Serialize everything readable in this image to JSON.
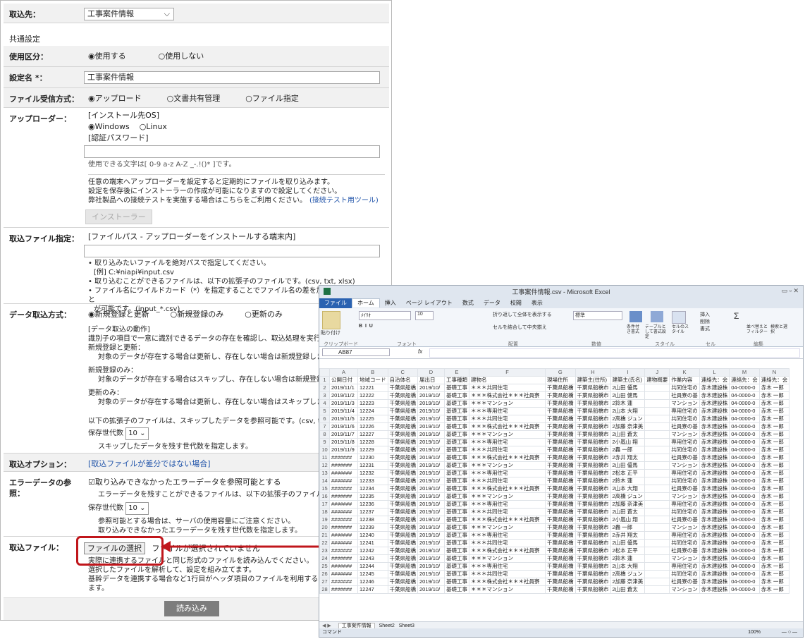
{
  "form": {
    "source_label": "取込先：",
    "source_value": "工事案件情報",
    "common_heading": "共通設定",
    "usage_label": "使用区分：",
    "usage_on": "◉使用する",
    "usage_off": "○使用しない",
    "setting_name_label": "設定名 *：",
    "setting_name_value": "工事案件情報",
    "receive_label": "ファイル受信方式：",
    "receive_upload": "◉アップロード",
    "receive_docshare": "○文書共有管理",
    "receive_file": "○ファイル指定",
    "uploader_label": "アップローダー：",
    "install_os_label": "[インストール先OS]",
    "os_windows": "◉Windows",
    "os_linux": "○Linux",
    "auth_pw_label": "[認証パスワード]",
    "pw_hint": "使用できる文字は[ 0-9 a-z A-Z _-.!()* ]です。",
    "uploader_note1": "任意の端末へアップローダーを設定すると定期的にファイルを取り込みます。",
    "uploader_note2": "設定を保存後にインストーラーの作成が可能になりますので設定してください。",
    "uploader_note3": "弊社製品への接続テストを実施する場合はこちらをご利用ください。",
    "uploader_note3_link": "(接続テスト用ツール)",
    "installer_button": "インストーラー",
    "import_file_label": "取込ファイル指定：",
    "file_path_label": "[ファイルパス - アップローダーをインストールする端末内]",
    "path_note1": "• 取り込みたいファイルを絶対パスで指定してください。",
    "path_note2": "[例] C:¥niapi¥input.csv",
    "path_note3": "• 取り込むことができるファイルは、以下の拡張子のファイルです。(csv, txt, xlsx)",
    "path_note4": "• ファイル名にワイルドカード（*）を指定することでファイル名の差を加味して取り込むこと",
    "path_note5": "が可能です。(input_*.csv)",
    "method_label": "データ取込方式：",
    "method_new_update": "◉新規登録と更新",
    "method_new_only": "○新規登録のみ",
    "method_update_only": "○更新のみ",
    "method_desc_title": "[データ取込の動作]",
    "method_desc1": "識別子の項目で一意に識別できるデータの存在を確認し、取込処理を実行し",
    "method_desc2": "新規登録と更新：",
    "method_desc3": "対象のデータが存在する場合は更新し、存在しない場合は新規登録します",
    "method_desc4": "新規登録のみ：",
    "method_desc5": "対象のデータが存在する場合はスキップし、存在しない場合は新規登録し",
    "method_desc6": "更新のみ：",
    "method_desc7": "対象のデータが存在する場合は更新し、存在しない場合はスキップします",
    "skip_note": "以下の拡張子のファイルは、スキップしたデータを参照可能です。(csv, txt",
    "keep_gen_label": "保存世代数",
    "keep_gen_value": "10",
    "skip_keep_note": "スキップしたデータを残す世代数を指定します。",
    "option_label": "取込オプション：",
    "option_link": "[取込ファイルが差分ではない場合]",
    "error_label": "エラーデータの参照：",
    "error_check": "☑取り込みできなかったエラーデータを参照可能とする",
    "error_note1": "エラーデータを残すことができるファイルは、以下の拡張子のファイルで",
    "error_keep_label": "保存世代数",
    "error_keep_value": "10",
    "error_note2": "参照可能とする場合は、サーバの使用容量にご注意ください。",
    "error_note3": "取り込みできなかったエラーデータを残す世代数を指定します。",
    "file_label": "取込ファイル：",
    "choose_file_button": "ファイルの選択",
    "no_file_text": "ファイルが選択されていません",
    "file_note1": "実際に連携するファイルと同じ形式のファイルを読み込んでください。",
    "file_note2": "選択したファイルを解析して、設定を組み立てます。",
    "file_note3": "基幹データを連携する場合など1行目がヘッダ項目のファイルを利用すると自",
    "file_note4": "ます。",
    "load_button": "読み込み"
  },
  "excel": {
    "title": "工事案件情報.csv - Microsoft Excel",
    "tabs": [
      "ファイル",
      "ホーム",
      "挿入",
      "ページ レイアウト",
      "数式",
      "データ",
      "校閲",
      "表示"
    ],
    "font_name": "ﾒｲﾘｵ",
    "font_size": "10",
    "wrap_text": "折り返して全体を表示する",
    "merge_center": "セルを結合して中央揃え",
    "number_format": "標準",
    "groups": [
      "クリップボード",
      "フォント",
      "配置",
      "数値",
      "スタイル",
      "セル",
      "編集"
    ],
    "cond_format": "条件付き書式",
    "table_format": "テーブルとして書式設定",
    "cell_style": "セルのスタイル",
    "insert": "挿入",
    "delete": "削除",
    "format": "書式",
    "sort": "並べ替えとフィルター",
    "find": "検索と選択",
    "paste": "貼り付け",
    "name_box": "AB87",
    "fx": "fx",
    "columns": [
      "A",
      "B",
      "C",
      "D",
      "E",
      "F",
      "G",
      "H",
      "I",
      "J",
      "K",
      "L",
      "M",
      "N"
    ],
    "headers": [
      "公開日付",
      "地域コード",
      "自治体名",
      "届出日",
      "工事種類",
      "建物名",
      "現場住所",
      "建築主(住所)",
      "建築主(氏名)",
      "建物概要",
      "作業内容",
      "連絡先：会",
      "連絡先：会",
      "連絡先：会"
    ],
    "rows": [
      [
        "2019/11/1",
        "12221",
        "千葉県船橋",
        "2019/10/",
        "基礎工事",
        "＊＊＊共同住宅",
        "千葉県船橋",
        "千葉県船橋市",
        "2山田 優馬",
        "",
        "共同住宅の",
        "赤木建設株",
        "04-0000-0",
        "赤木 一郎"
      ],
      [
        "2019/11/2",
        "12222",
        "千葉県船橋",
        "2019/10/",
        "基礎工事",
        "＊＊＊株式会社＊＊＊社員寮",
        "千葉県船橋",
        "千葉県船橋市",
        "2山田 健馬",
        "",
        "社員寮の基",
        "赤木建設株",
        "04-0000-0",
        "赤木 一郎"
      ],
      [
        "2019/11/3",
        "12223",
        "千葉県船橋",
        "2019/10/",
        "基礎工事",
        "＊＊＊マンション",
        "千葉県船橋",
        "千葉県船橋市",
        "2鈴木 蓮",
        "",
        "マンション",
        "赤木建設株",
        "04-0000-0",
        "赤木 一郎"
      ],
      [
        "2019/11/4",
        "12224",
        "千葉県船橋",
        "2019/10/",
        "基礎工事",
        "＊＊＊専用住宅",
        "千葉県船橋",
        "千葉県船橋市",
        "2山本 大翔",
        "",
        "専用住宅の",
        "赤木建設株",
        "04-0000-0",
        "赤木 一郎"
      ],
      [
        "2019/11/5",
        "12225",
        "千葉県船橋",
        "2019/10/",
        "基礎工事",
        "＊＊＊共同住宅",
        "千葉県船橋",
        "千葉県船橋市",
        "2高橋 ジュン",
        "",
        "共同住宅の",
        "赤木建設株",
        "04-0000-0",
        "赤木 一郎"
      ],
      [
        "2019/11/6",
        "12226",
        "千葉県船橋",
        "2019/10/",
        "基礎工事",
        "＊＊＊株式会社＊＊＊社員寮",
        "千葉県船橋",
        "千葉県船橋市",
        "2加藤 奈津美",
        "",
        "社員寮の基",
        "赤木建設株",
        "04-0000-0",
        "赤木 一郎"
      ],
      [
        "2019/11/7",
        "12227",
        "千葉県船橋",
        "2019/10/",
        "基礎工事",
        "＊＊＊マンション",
        "千葉県船橋",
        "千葉県船橋市",
        "2山田 蒼太",
        "",
        "マンション",
        "赤木建設株",
        "04-0000-0",
        "赤木 一郎"
      ],
      [
        "2019/11/8",
        "12228",
        "千葉県船橋",
        "2019/10/",
        "基礎工事",
        "＊＊＊専用住宅",
        "千葉県船橋",
        "千葉県船橋市",
        "2小嵐山 翔",
        "",
        "専用住宅の",
        "赤木建設株",
        "04-0000-0",
        "赤木 一郎"
      ],
      [
        "2019/11/9",
        "12229",
        "千葉県船橋",
        "2019/10/",
        "基礎工事",
        "＊＊＊共同住宅",
        "千葉県船橋",
        "千葉県船橋市",
        "2轟 一郎",
        "",
        "共同住宅の",
        "赤木建設株",
        "04-0000-0",
        "赤木 一郎"
      ],
      [
        "#######",
        "12230",
        "千葉県船橋",
        "2019/10/",
        "基礎工事",
        "＊＊＊株式会社＊＊＊社員寮",
        "千葉県船橋",
        "千葉県船橋市",
        "2赤井 翔太",
        "",
        "社員寮の基",
        "赤木建設株",
        "04-0000-0",
        "赤木 一郎"
      ],
      [
        "#######",
        "12231",
        "千葉県船橋",
        "2019/10/",
        "基礎工事",
        "＊＊＊マンション",
        "千葉県船橋",
        "千葉県船橋市",
        "2山田 優馬",
        "",
        "マンション",
        "赤木建設株",
        "04-0000-0",
        "赤木 一郎"
      ],
      [
        "#######",
        "12232",
        "千葉県船橋",
        "2019/10/",
        "基礎工事",
        "＊＊＊専用住宅",
        "千葉県船橋",
        "千葉県船橋市",
        "2松本 正平",
        "",
        "専用住宅の",
        "赤木建設株",
        "04-0000-0",
        "赤木 一郎"
      ],
      [
        "#######",
        "12233",
        "千葉県船橋",
        "2019/10/",
        "基礎工事",
        "＊＊＊共同住宅",
        "千葉県船橋",
        "千葉県船橋市",
        "2鈴木 蓮",
        "",
        "共同住宅の",
        "赤木建設株",
        "04-0000-0",
        "赤木 一郎"
      ],
      [
        "#######",
        "12234",
        "千葉県船橋",
        "2019/10/",
        "基礎工事",
        "＊＊＊株式会社＊＊＊社員寮",
        "千葉県船橋",
        "千葉県船橋市",
        "2山本 大翔",
        "",
        "社員寮の基",
        "赤木建設株",
        "04-0000-0",
        "赤木 一郎"
      ],
      [
        "#######",
        "12235",
        "千葉県船橋",
        "2019/10/",
        "基礎工事",
        "＊＊＊マンション",
        "千葉県船橋",
        "千葉県船橋市",
        "2高橋 ジュン",
        "",
        "マンション",
        "赤木建設株",
        "04-0000-0",
        "赤木 一郎"
      ],
      [
        "#######",
        "12236",
        "千葉県船橋",
        "2019/10/",
        "基礎工事",
        "＊＊＊専用住宅",
        "千葉県船橋",
        "千葉県船橋市",
        "2加藤 奈津美",
        "",
        "専用住宅の",
        "赤木建設株",
        "04-0000-0",
        "赤木 一郎"
      ],
      [
        "#######",
        "12237",
        "千葉県船橋",
        "2019/10/",
        "基礎工事",
        "＊＊＊共同住宅",
        "千葉県船橋",
        "千葉県船橋市",
        "2山田 蒼太",
        "",
        "共同住宅の",
        "赤木建設株",
        "04-0000-0",
        "赤木 一郎"
      ],
      [
        "#######",
        "12238",
        "千葉県船橋",
        "2019/10/",
        "基礎工事",
        "＊＊＊株式会社＊＊＊社員寮",
        "千葉県船橋",
        "千葉県船橋市",
        "2小嵐山 翔",
        "",
        "社員寮の基",
        "赤木建設株",
        "04-0000-0",
        "赤木 一郎"
      ],
      [
        "#######",
        "12239",
        "千葉県船橋",
        "2019/10/",
        "基礎工事",
        "＊＊＊マンション",
        "千葉県船橋",
        "千葉県船橋市",
        "2轟 一郎",
        "",
        "マンション",
        "赤木建設株",
        "04-0000-0",
        "赤木 一郎"
      ],
      [
        "#######",
        "12240",
        "千葉県船橋",
        "2019/10/",
        "基礎工事",
        "＊＊＊専用住宅",
        "千葉県船橋",
        "千葉県船橋市",
        "2赤井 翔太",
        "",
        "専用住宅の",
        "赤木建設株",
        "04-0000-0",
        "赤木 一郎"
      ],
      [
        "#######",
        "12241",
        "千葉県船橋",
        "2019/10/",
        "基礎工事",
        "＊＊＊共同住宅",
        "千葉県船橋",
        "千葉県船橋市",
        "2山田 優馬",
        "",
        "共同住宅の",
        "赤木建設株",
        "04-0000-0",
        "赤木 一郎"
      ],
      [
        "#######",
        "12242",
        "千葉県船橋",
        "2019/10/",
        "基礎工事",
        "＊＊＊株式会社＊＊＊社員寮",
        "千葉県船橋",
        "千葉県船橋市",
        "2松本 正平",
        "",
        "社員寮の基",
        "赤木建設株",
        "04-0000-0",
        "赤木 一郎"
      ],
      [
        "#######",
        "12243",
        "千葉県船橋",
        "2019/10/",
        "基礎工事",
        "＊＊＊マンション",
        "千葉県船橋",
        "千葉県船橋市",
        "2鈴木 蓮",
        "",
        "マンション",
        "赤木建設株",
        "04-0000-0",
        "赤木 一郎"
      ],
      [
        "#######",
        "12244",
        "千葉県船橋",
        "2019/10/",
        "基礎工事",
        "＊＊＊専用住宅",
        "千葉県船橋",
        "千葉県船橋市",
        "2山本 大翔",
        "",
        "専用住宅の",
        "赤木建設株",
        "04-0000-0",
        "赤木 一郎"
      ],
      [
        "#######",
        "12245",
        "千葉県船橋",
        "2019/10/",
        "基礎工事",
        "＊＊＊共同住宅",
        "千葉県船橋",
        "千葉県船橋市",
        "2高橋 ジュン",
        "",
        "共同住宅の",
        "赤木建設株",
        "04-0000-0",
        "赤木 一郎"
      ],
      [
        "#######",
        "12246",
        "千葉県船橋",
        "2019/10/",
        "基礎工事",
        "＊＊＊株式会社＊＊＊社員寮",
        "千葉県船橋",
        "千葉県船橋市",
        "2加藤 奈津美",
        "",
        "社員寮の基",
        "赤木建設株",
        "04-0000-0",
        "赤木 一郎"
      ],
      [
        "#######",
        "12247",
        "千葉県船橋",
        "2019/10/",
        "基礎工事",
        "＊＊＊マンション",
        "千葉県船橋",
        "千葉県船橋市",
        "2山田 蒼太",
        "",
        "マンション",
        "赤木建設株",
        "04-0000-0",
        "赤木 一郎"
      ]
    ],
    "sheets": [
      "工事案件情報",
      "Sheet2",
      "Sheet3"
    ],
    "status_left": "コマンド",
    "zoom": "100%"
  },
  "colors": {
    "arrow": "#c0161b",
    "highlight": "#c0161b",
    "load_button": "#7d7d7d"
  }
}
